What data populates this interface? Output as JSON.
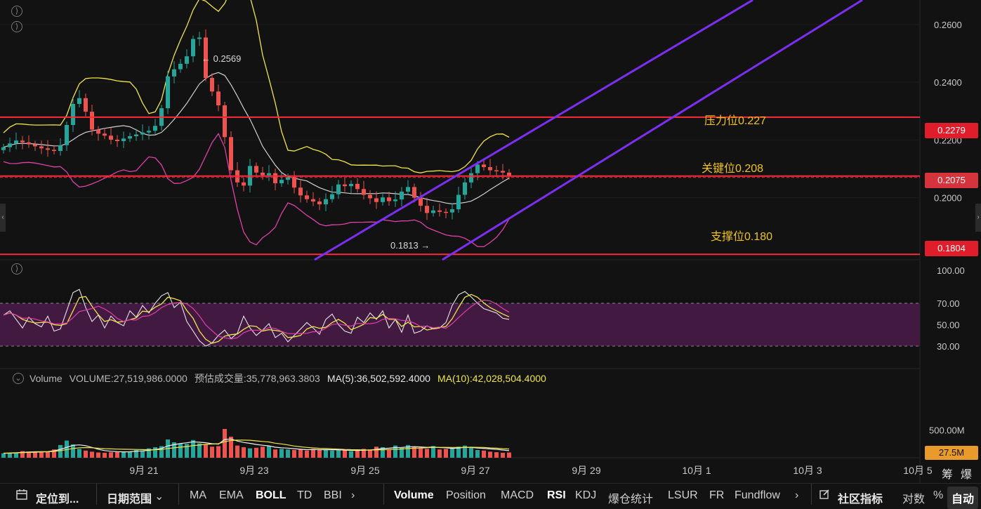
{
  "chart_data": [
    {
      "type": "candlestick",
      "title": "",
      "x_tick_labels": [
        "9月 21",
        "9月 23",
        "9月 25",
        "9月 27",
        "9月 29",
        "10月 1",
        "10月 3",
        "10月 5"
      ],
      "y_tick_labels": [
        "0.2600",
        "0.2400",
        "0.2200",
        "0.2000"
      ],
      "ylim": [
        0.1785,
        0.2685
      ],
      "indicators": [
        "BOLL"
      ],
      "horizontal_lines": [
        {
          "price": 0.2279,
          "label": "压力位0.227",
          "color": "#ff2a3a"
        },
        {
          "price": 0.2075,
          "label": "关键位0.208",
          "color": "#ff2a3a"
        },
        {
          "price": 0.1804,
          "label": "支撑位0.180",
          "color": "#ff2a3a"
        }
      ],
      "price_tags": [
        {
          "value": "0.2279",
          "color": "#e01e2b"
        },
        {
          "value": "0.2075",
          "color": "#d7333c"
        },
        {
          "value": "0.1804",
          "color": "#e01e2b"
        }
      ],
      "markers": [
        {
          "text": "← 0.2569",
          "kind": "high"
        },
        {
          "text": "0.1813 →",
          "kind": "low"
        }
      ],
      "channel_color": "#7b2ff0",
      "series": [
        {
          "name": "close",
          "values": [
            0.2175,
            0.2188,
            0.2198,
            0.2192,
            0.2185,
            0.2178,
            0.2171,
            0.2166,
            0.2162,
            0.2182,
            0.2252,
            0.2325,
            0.2345,
            0.2298,
            0.2236,
            0.2222,
            0.2215,
            0.2201,
            0.2196,
            0.2205,
            0.2213,
            0.2219,
            0.2226,
            0.2232,
            0.2249,
            0.231,
            0.242,
            0.2445,
            0.2464,
            0.249,
            0.255,
            0.2555,
            0.2415,
            0.2368,
            0.232,
            0.221,
            0.2095,
            0.2053,
            0.2042,
            0.211,
            0.2087,
            0.2078,
            0.2085,
            0.205,
            0.2062,
            0.2072,
            0.2035,
            0.2008,
            0.1995,
            0.1987,
            0.1977,
            0.1995,
            0.2012,
            0.2046,
            0.204,
            0.2048,
            0.203,
            0.201,
            0.1998,
            0.1985,
            0.2001,
            0.1988,
            0.1994,
            0.2021,
            0.2037,
            0.2,
            0.1972,
            0.1947,
            0.1956,
            0.1951,
            0.1949,
            0.196,
            0.201,
            0.2053,
            0.2085,
            0.2115,
            0.2106,
            0.2095,
            0.2093,
            0.2087,
            0.2075
          ]
        }
      ]
    },
    {
      "type": "line",
      "title": "",
      "indicator": "RSI",
      "y_tick_labels": [
        "100.00",
        "70.00",
        "50.00",
        "30.00"
      ],
      "ylim": [
        0,
        100
      ],
      "band": [
        30,
        70
      ],
      "series": [
        {
          "name": "RSI",
          "values": [
            59,
            63,
            55,
            47,
            57,
            51,
            48,
            58,
            44,
            46,
            63,
            80,
            83,
            66,
            53,
            59,
            47,
            58,
            52,
            49,
            63,
            57,
            68,
            61,
            70,
            77,
            80,
            66,
            71,
            53,
            44,
            35,
            30,
            33,
            40,
            45,
            37,
            42,
            58,
            47,
            40,
            45,
            51,
            38,
            42,
            34,
            40,
            46,
            52,
            47,
            41,
            55,
            60,
            50,
            44,
            42,
            57,
            52,
            61,
            55,
            63,
            47,
            55,
            43,
            59,
            42,
            44,
            49,
            46,
            47,
            52,
            68,
            78,
            81,
            76,
            70,
            65,
            63,
            61,
            56,
            55
          ]
        }
      ]
    },
    {
      "type": "bar",
      "title": "",
      "indicator": "Volume",
      "y_tick_labels": [
        "500.00M"
      ],
      "ylim": [
        0,
        850
      ],
      "series": [
        {
          "name": "volume",
          "values": [
            80,
            85,
            90,
            120,
            110,
            95,
            100,
            105,
            150,
            230,
            310,
            240,
            160,
            130,
            110,
            95,
            90,
            100,
            105,
            110,
            115,
            140,
            130,
            170,
            190,
            210,
            330,
            280,
            260,
            250,
            320,
            260,
            240,
            200,
            210,
            520,
            380,
            220,
            190,
            170,
            180,
            200,
            210,
            150,
            160,
            150,
            140,
            150,
            130,
            160,
            140,
            150,
            130,
            140,
            140,
            120,
            130,
            160,
            150,
            200,
            190,
            150,
            220,
            180,
            230,
            200,
            170,
            160,
            210,
            150,
            160,
            170,
            200,
            220,
            180,
            140,
            130,
            110,
            100,
            90,
            95
          ]
        },
        {
          "name": "MA(5)",
          "values": [
            82,
            86,
            90,
            98,
            104,
            108,
            110,
            112,
            124,
            152,
            188,
            224,
            232,
            218,
            186,
            154,
            130,
            118,
            110,
            106,
            108,
            118,
            124,
            134,
            150,
            168,
            214,
            236,
            258,
            270,
            288,
            280,
            272,
            254,
            246,
            330,
            340,
            302,
            276,
            260,
            240,
            226,
            214,
            190,
            180,
            174,
            164,
            154,
            146,
            148,
            146,
            146,
            144,
            144,
            138,
            134,
            132,
            136,
            140,
            152,
            166,
            172,
            184,
            186,
            196,
            200,
            196,
            188,
            194,
            184,
            180,
            170,
            176,
            188,
            186,
            176,
            170,
            160,
            152,
            140,
            128
          ]
        },
        {
          "name": "MA(10)",
          "values": [
            80,
            82,
            86,
            92,
            96,
            100,
            104,
            108,
            115,
            128,
            148,
            168,
            180,
            184,
            180,
            171,
            164,
            160,
            156,
            154,
            152,
            150,
            147,
            144,
            146,
            150,
            168,
            180,
            192,
            202,
            220,
            230,
            242,
            248,
            254,
            290,
            312,
            318,
            318,
            316,
            304,
            294,
            286,
            262,
            250,
            232,
            212,
            198,
            186,
            178,
            170,
            166,
            160,
            156,
            150,
            146,
            144,
            142,
            140,
            142,
            144,
            148,
            152,
            158,
            166,
            172,
            176,
            180,
            186,
            188,
            188,
            186,
            186,
            188,
            190,
            188,
            186,
            178,
            172,
            164,
            158
          ]
        }
      ]
    }
  ],
  "panels": {
    "rsi_toggle": "⟩",
    "volume_toggle": "⌄",
    "top_toggles": [
      "⟩",
      "⟩"
    ]
  },
  "legend": {
    "name": "Volume",
    "volume": "VOLUME:27,519,986.0000",
    "estimate": "预估成交量:35,778,963.3803",
    "ma5": "MA(5):36,502,592.4000",
    "ma10": "MA(10):42,028,504.4000",
    "ma10_color": "#f0e54a"
  },
  "volume_tag": {
    "value": "27.5M",
    "color": "#e89a2a"
  },
  "colors": {
    "up": "#26a69a",
    "down": "#ef5350",
    "boll_upper": "#f0e54a",
    "boll_mid": "#d0d0d0",
    "boll_lower": "#e040a8",
    "rsi_band": "#4a1b4a"
  },
  "toolbar": {
    "locate": "定位到...",
    "date_range": "日期范围",
    "chevron": "⌄",
    "indicators_left": [
      "MA",
      "EMA",
      "BOLL",
      "TD",
      "BBI"
    ],
    "more_left": "›",
    "indicators_right": [
      "Volume",
      "Position",
      "MACD",
      "RSI",
      "KDJ",
      "爆仓统计",
      "LSUR",
      "FR",
      "Fundflow"
    ],
    "more_right": "›",
    "community": "社区指标",
    "log": "对数",
    "percent": "%",
    "auto": "自动"
  },
  "side_tabs": {
    "chip": "筹",
    "liq": "爆"
  }
}
